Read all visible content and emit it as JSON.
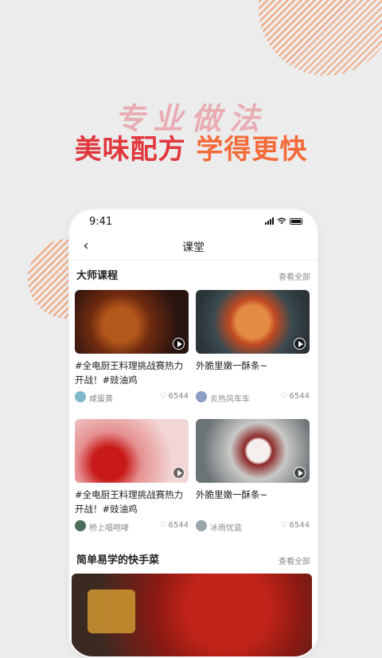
{
  "hero": {
    "script_text": "专业做法",
    "title_part1": "美味配方",
    "title_part2": "学得更快"
  },
  "phone": {
    "status_time": "9:41",
    "nav": {
      "back_icon": "chevron-left-icon",
      "title": "课堂"
    },
    "sections": [
      {
        "title": "大师课程",
        "see_all": "查看全部"
      },
      {
        "title": "简单易学的快手菜",
        "see_all": "查看全部"
      }
    ],
    "cards": [
      {
        "title": "#全电厨王料理挑战赛热力开战！#豉油鸡",
        "author": "咸蛋黄",
        "likes": "6544",
        "image": "chicken-wings"
      },
      {
        "title": "外脆里嫩一酥条~",
        "author": "炎热风车车",
        "likes": "6544",
        "image": "noodles"
      },
      {
        "title": "#全电厨王料理挑战赛热力开战！#豉油鸡",
        "author": "桥上唱咆哮",
        "likes": "6544",
        "image": "apples"
      },
      {
        "title": "外脆里嫩一酥条~",
        "author": "冰雨忧蓝",
        "likes": "6544",
        "image": "ribs"
      }
    ]
  },
  "colors": {
    "accent_red": "#e0383e",
    "accent_orange": "#f36b3b",
    "deco": "#f3a57e"
  }
}
